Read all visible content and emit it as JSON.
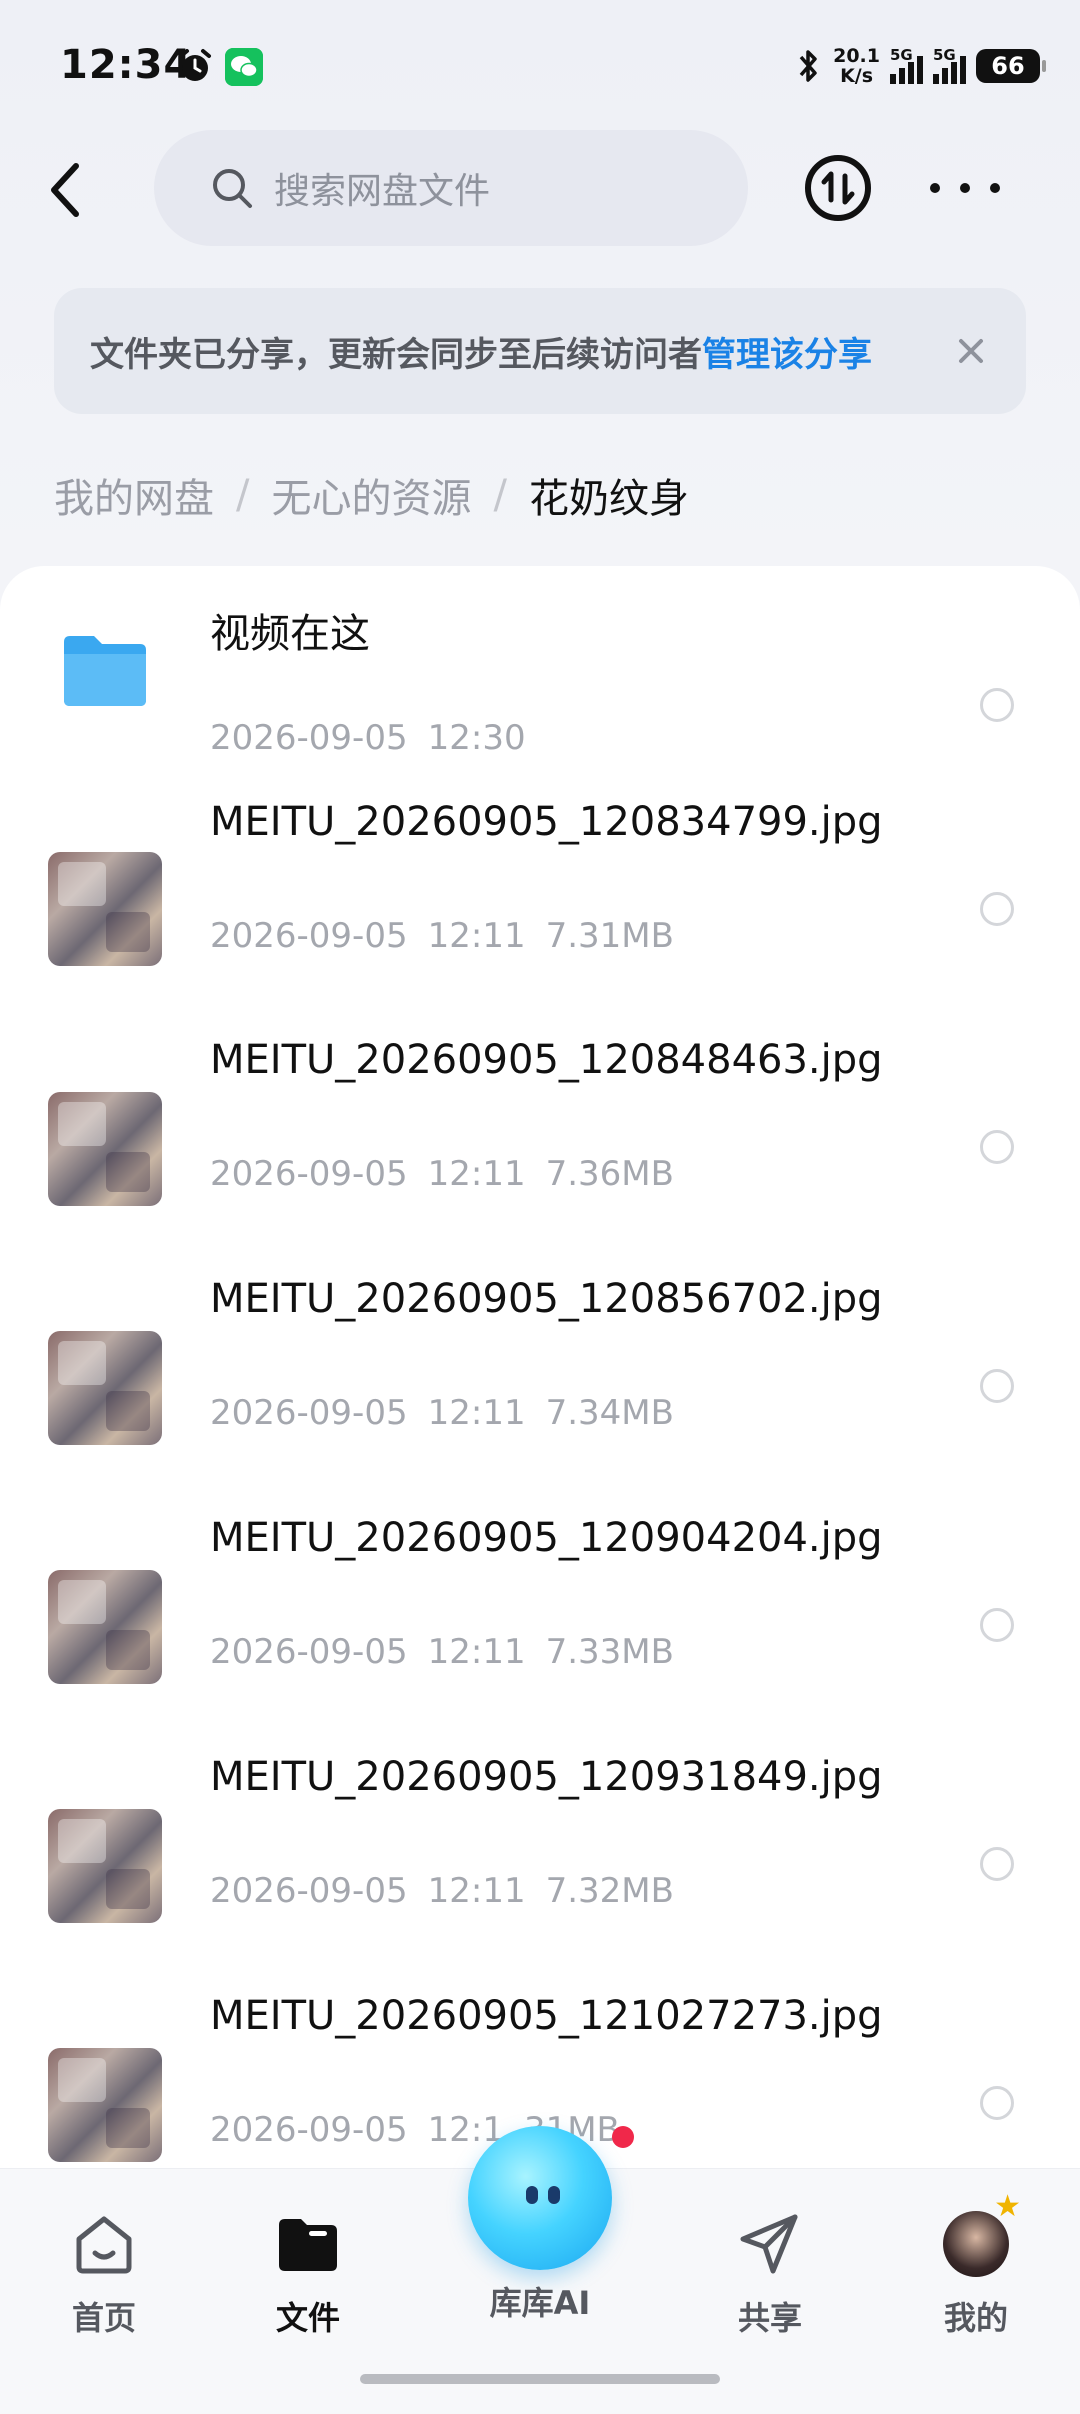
{
  "status_bar": {
    "time": "12:34",
    "net_speed_value": "20.1",
    "net_speed_unit": "K/s",
    "signal1_label": "5G",
    "signal2_label": "5G",
    "battery": "66"
  },
  "header": {
    "search_placeholder": "搜索网盘文件"
  },
  "banner": {
    "message": "文件夹已分享，更新会同步至后续访问者",
    "link": "管理该分享"
  },
  "breadcrumb": [
    "我的网盘",
    "无心的资源",
    "花奶纹身"
  ],
  "items": [
    {
      "type": "folder",
      "name": "视频在这",
      "date": "2026-09-05",
      "time": "12:30",
      "size": ""
    },
    {
      "type": "image",
      "name": "MEITU_20260905_120834799.jpg",
      "date": "2026-09-05",
      "time": "12:11",
      "size": "7.31MB"
    },
    {
      "type": "image",
      "name": "MEITU_20260905_120848463.jpg",
      "date": "2026-09-05",
      "time": "12:11",
      "size": "7.36MB"
    },
    {
      "type": "image",
      "name": "MEITU_20260905_120856702.jpg",
      "date": "2026-09-05",
      "time": "12:11",
      "size": "7.34MB"
    },
    {
      "type": "image",
      "name": "MEITU_20260905_120904204.jpg",
      "date": "2026-09-05",
      "time": "12:11",
      "size": "7.33MB"
    },
    {
      "type": "image",
      "name": "MEITU_20260905_120931849.jpg",
      "date": "2026-09-05",
      "time": "12:11",
      "size": "7.32MB"
    },
    {
      "type": "image",
      "name": "MEITU_20260905_121027273.jpg",
      "date": "2026-09-05",
      "time": "12:1",
      "size": "31MB"
    }
  ],
  "nav": {
    "home": "首页",
    "files": "文件",
    "ai": "库库AI",
    "share": "共享",
    "me": "我的"
  },
  "colors": {
    "accent": "#1a82e6",
    "folder": "#3aa8f0",
    "ai_badge": "#f0284a"
  }
}
